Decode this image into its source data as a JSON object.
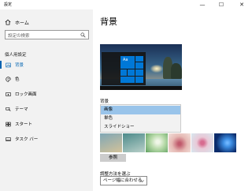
{
  "window": {
    "title": "設定",
    "controls": {
      "minimize": "—",
      "maximize": "☐",
      "close": "✕"
    }
  },
  "sidebar": {
    "home_label": "ホーム",
    "search_placeholder": "設定の検索",
    "section_title": "個人用設定",
    "items": [
      {
        "label": "背景",
        "icon": "image-icon",
        "active": true
      },
      {
        "label": "色",
        "icon": "palette-icon",
        "active": false
      },
      {
        "label": "ロック画面",
        "icon": "lock-screen-icon",
        "active": false
      },
      {
        "label": "テーマ",
        "icon": "theme-icon",
        "active": false
      },
      {
        "label": "スタート",
        "icon": "start-icon",
        "active": false
      },
      {
        "label": "タスク バー",
        "icon": "taskbar-icon",
        "active": false
      }
    ]
  },
  "main": {
    "title": "背景",
    "preview": {
      "tile_text": "Aa"
    },
    "background_label": "背景",
    "background_options": [
      {
        "label": "画像",
        "selected": true
      },
      {
        "label": "単色",
        "selected": false
      },
      {
        "label": "スライドショー",
        "selected": false
      }
    ],
    "thumbnails": [
      {
        "name": "beach-rocks",
        "colors": [
          "#7fa6b5",
          "#d3c29a"
        ]
      },
      {
        "name": "coast",
        "colors": [
          "#4c8a8a",
          "#b8cfc8"
        ]
      },
      {
        "name": "spring",
        "colors": [
          "#b6d9a8",
          "#5fa060"
        ]
      },
      {
        "name": "flower",
        "colors": [
          "#e6b9b4",
          "#c05a6c"
        ]
      },
      {
        "name": "pink-flower",
        "colors": [
          "#d7e7ef",
          "#d76b8f"
        ]
      },
      {
        "name": "windows",
        "colors": [
          "#0a2b6b",
          "#3d8ee3"
        ]
      }
    ],
    "browse_label": "参照",
    "fit_label": "調整方法を選ぶ",
    "fit_value": "ページ幅に合わせる"
  }
}
